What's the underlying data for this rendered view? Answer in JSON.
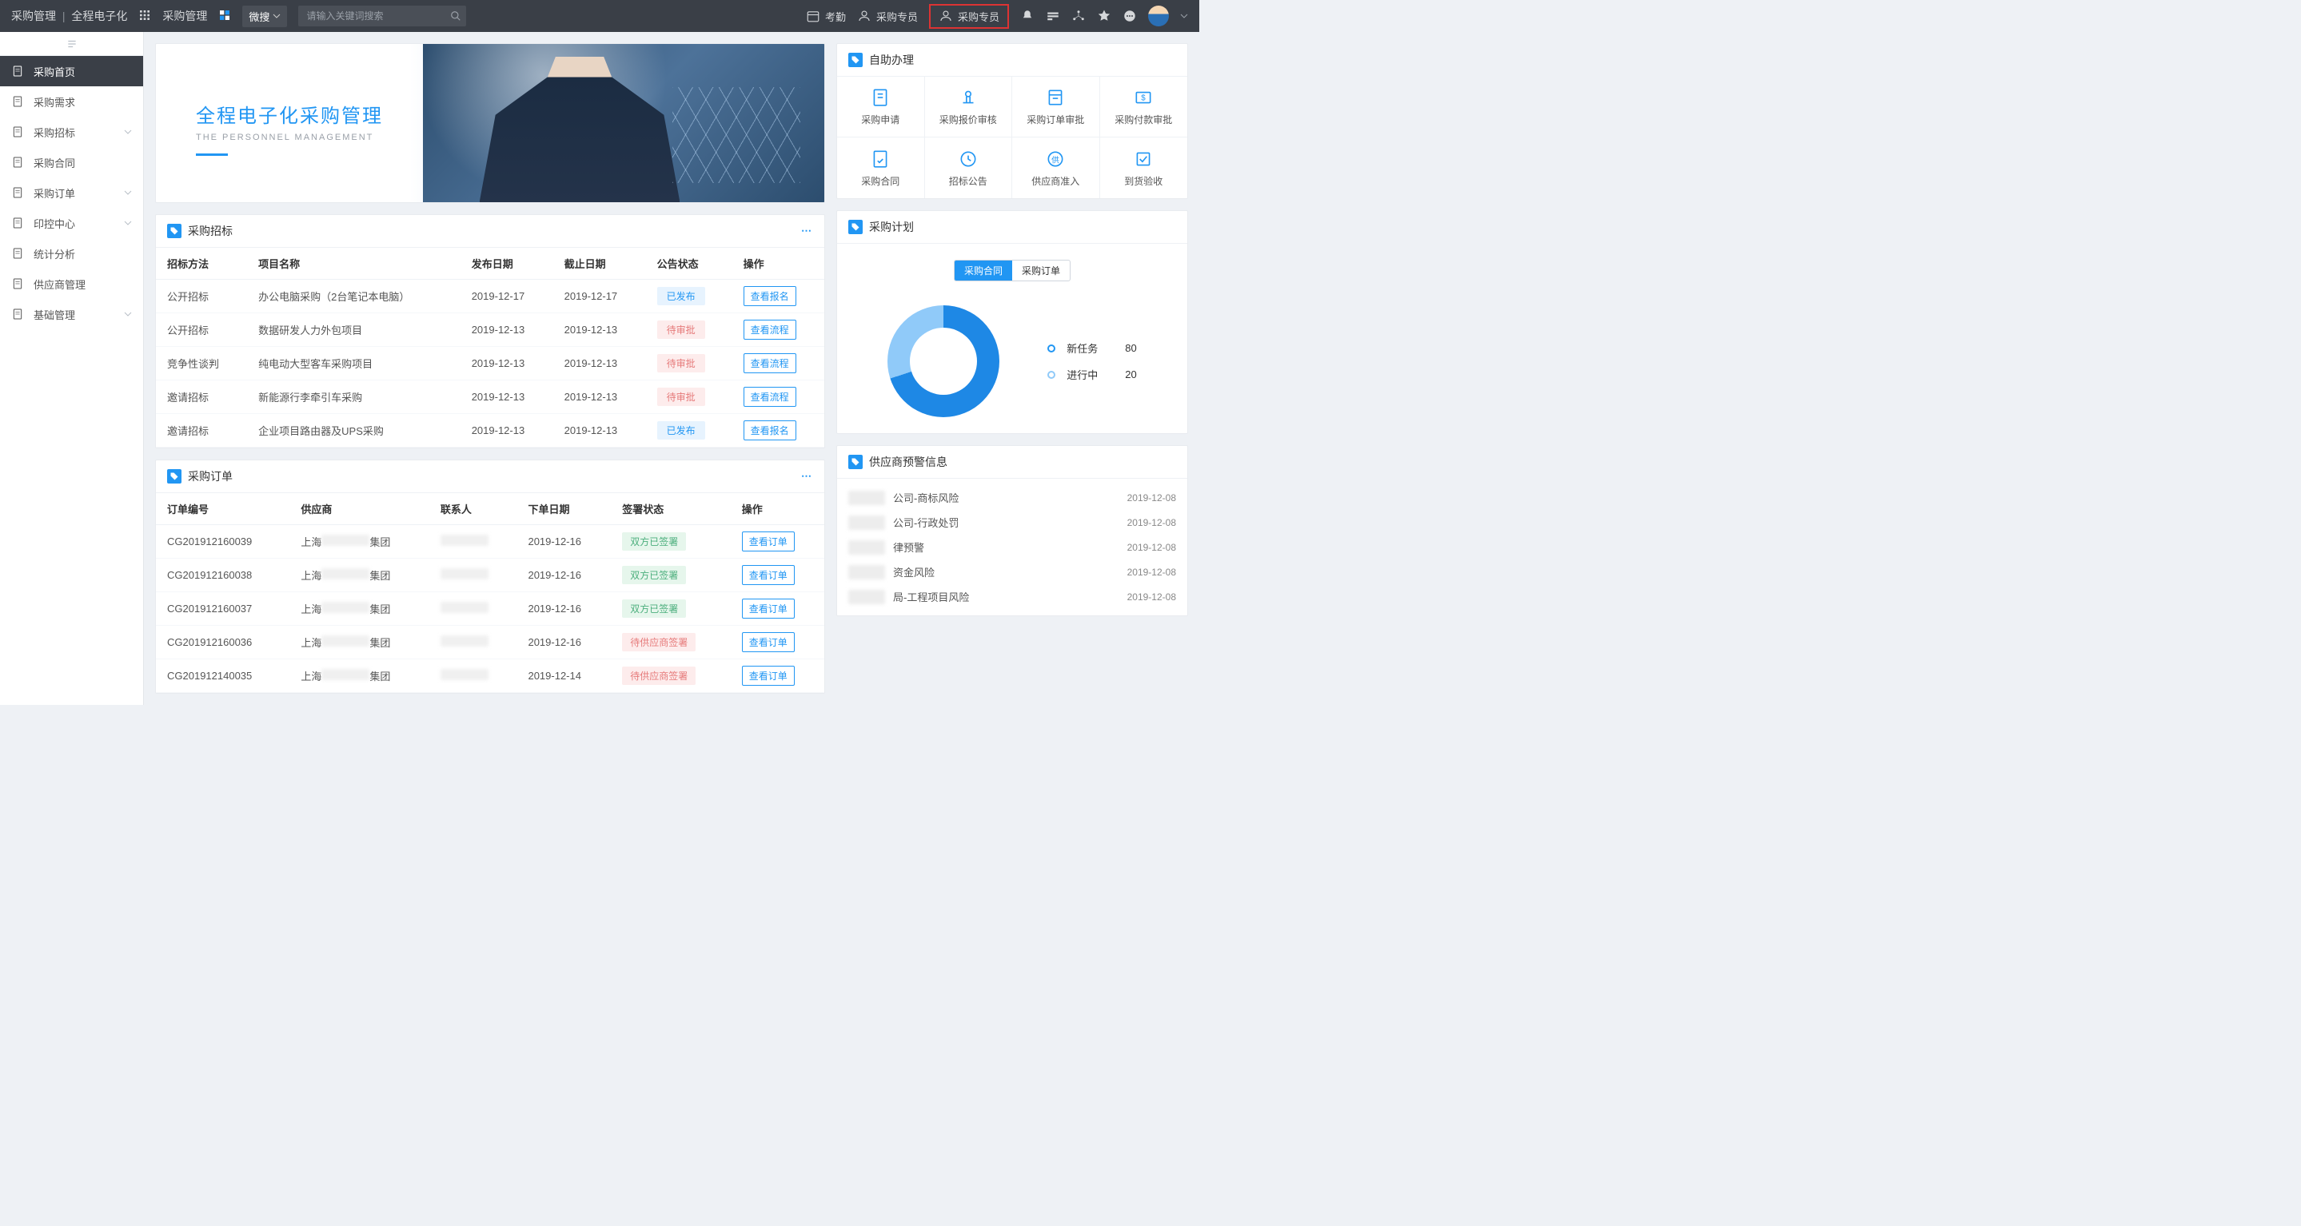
{
  "header": {
    "brand_main": "采购管理",
    "brand_sub": "全程电子化",
    "module": "采购管理",
    "search_scope": "微搜",
    "search_placeholder": "请输入关键词搜索",
    "nav_attendance": "考勤",
    "nav_role1": "采购专员",
    "nav_role2": "采购专员"
  },
  "sidebar": {
    "items": [
      {
        "label": "采购首页",
        "expandable": false,
        "active": true
      },
      {
        "label": "采购需求",
        "expandable": false
      },
      {
        "label": "采购招标",
        "expandable": true
      },
      {
        "label": "采购合同",
        "expandable": false
      },
      {
        "label": "采购订单",
        "expandable": true
      },
      {
        "label": "印控中心",
        "expandable": true
      },
      {
        "label": "统计分析",
        "expandable": false
      },
      {
        "label": "供应商管理",
        "expandable": false
      },
      {
        "label": "基础管理",
        "expandable": true
      }
    ]
  },
  "banner": {
    "title_zh": "全程电子化采购管理",
    "title_en": "THE PERSONNEL MANAGEMENT"
  },
  "selfservice": {
    "title": "自助办理",
    "items": [
      {
        "label": "采购申请"
      },
      {
        "label": "采购报价审核"
      },
      {
        "label": "采购订单审批"
      },
      {
        "label": "采购付款审批"
      },
      {
        "label": "采购合同"
      },
      {
        "label": "招标公告"
      },
      {
        "label": "供应商准入"
      },
      {
        "label": "到货验收"
      }
    ]
  },
  "bidding": {
    "title": "采购招标",
    "columns": [
      "招标方法",
      "项目名称",
      "发布日期",
      "截止日期",
      "公告状态",
      "操作"
    ],
    "rows": [
      {
        "method": "公开招标",
        "name": "办公电脑采购（2台笔记本电脑）",
        "pub": "2019-12-17",
        "end": "2019-12-17",
        "status": "已发布",
        "status_style": "blue",
        "action": "查看报名"
      },
      {
        "method": "公开招标",
        "name": "数据研发人力外包项目",
        "pub": "2019-12-13",
        "end": "2019-12-13",
        "status": "待审批",
        "status_style": "pink",
        "action": "查看流程"
      },
      {
        "method": "竞争性谈判",
        "name": "纯电动大型客车采购项目",
        "pub": "2019-12-13",
        "end": "2019-12-13",
        "status": "待审批",
        "status_style": "pink",
        "action": "查看流程"
      },
      {
        "method": "邀请招标",
        "name": "新能源行李牵引车采购",
        "pub": "2019-12-13",
        "end": "2019-12-13",
        "status": "待审批",
        "status_style": "pink",
        "action": "查看流程"
      },
      {
        "method": "邀请招标",
        "name": "企业项目路由器及UPS采购",
        "pub": "2019-12-13",
        "end": "2019-12-13",
        "status": "已发布",
        "status_style": "blue",
        "action": "查看报名"
      }
    ]
  },
  "orders": {
    "title": "采购订单",
    "columns": [
      "订单编号",
      "供应商",
      "联系人",
      "下单日期",
      "签署状态",
      "操作"
    ],
    "supplier_prefix": "上海",
    "supplier_suffix": "集团",
    "rows": [
      {
        "no": "CG201912160039",
        "date": "2019-12-16",
        "status": "双方已签署",
        "status_style": "green",
        "action": "查看订单"
      },
      {
        "no": "CG201912160038",
        "date": "2019-12-16",
        "status": "双方已签署",
        "status_style": "green",
        "action": "查看订单"
      },
      {
        "no": "CG201912160037",
        "date": "2019-12-16",
        "status": "双方已签署",
        "status_style": "green",
        "action": "查看订单"
      },
      {
        "no": "CG201912160036",
        "date": "2019-12-16",
        "status": "待供应商签署",
        "status_style": "pink",
        "action": "查看订单"
      },
      {
        "no": "CG201912140035",
        "date": "2019-12-14",
        "status": "待供应商签署",
        "status_style": "pink",
        "action": "查看订单"
      }
    ]
  },
  "plan": {
    "title": "采购计划",
    "tab1": "采购合同",
    "tab2": "采购订单",
    "legend": [
      {
        "label": "新任务",
        "value": "80"
      },
      {
        "label": "进行中",
        "value": "20"
      }
    ]
  },
  "chart_data": {
    "type": "pie",
    "title": "采购计划 — 采购合同",
    "series": [
      {
        "name": "新任务",
        "value": 80
      },
      {
        "name": "进行中",
        "value": 20
      }
    ],
    "colors": [
      "#1e88e5",
      "#90caf9"
    ],
    "inner_radius": 0.55,
    "legend_position": "right"
  },
  "alerts": {
    "title": "供应商预警信息",
    "rows": [
      {
        "text": "公司-商标风险",
        "date": "2019-12-08"
      },
      {
        "text": "公司-行政处罚",
        "date": "2019-12-08"
      },
      {
        "text": "律预警",
        "date": "2019-12-08"
      },
      {
        "text": "资金风险",
        "date": "2019-12-08"
      },
      {
        "text": "局-工程项目风险",
        "date": "2019-12-08"
      }
    ]
  }
}
